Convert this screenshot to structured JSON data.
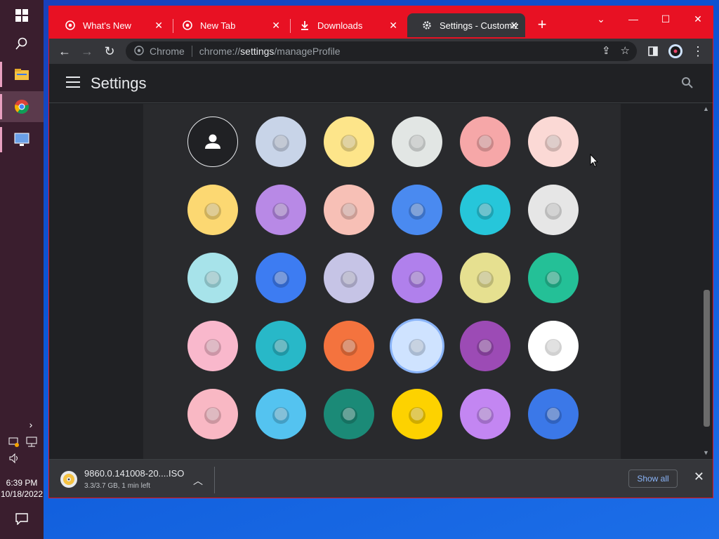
{
  "taskbar": {
    "start_icon": "windows-start-icon",
    "search_icon": "search-icon",
    "apps": [
      {
        "name": "file-explorer-icon"
      },
      {
        "name": "chrome-icon"
      },
      {
        "name": "remote-desktop-icon"
      }
    ],
    "time": "6:39 PM",
    "date": "10/18/2022"
  },
  "browser": {
    "tabs": [
      {
        "title": "What's New",
        "icon": "chrome-icon"
      },
      {
        "title": "New Tab",
        "icon": "chrome-icon"
      },
      {
        "title": "Downloads",
        "icon": "download-icon"
      },
      {
        "title": "Settings - Customiz",
        "icon": "gear-icon",
        "active": true
      }
    ],
    "omnibox": {
      "chip": "Chrome",
      "url_prefix": "chrome://",
      "url_host": "settings",
      "url_path": "/manageProfile"
    }
  },
  "settings": {
    "title": "Settings"
  },
  "avatars": [
    {
      "name": "avatar-default",
      "bg": "#202124",
      "ring": "#e8eaed"
    },
    {
      "name": "avatar-cat",
      "bg": "#c8d4e8"
    },
    {
      "name": "avatar-corgi",
      "bg": "#fde58a"
    },
    {
      "name": "avatar-dragon",
      "bg": "#e2e6e4"
    },
    {
      "name": "avatar-elephant",
      "bg": "#f6a7a8"
    },
    {
      "name": "avatar-fox",
      "bg": "#fbd9d5"
    },
    {
      "name": "avatar-monkey",
      "bg": "#fcd872"
    },
    {
      "name": "avatar-panda",
      "bg": "#b889e6"
    },
    {
      "name": "avatar-penguin",
      "bg": "#f7c0b6"
    },
    {
      "name": "avatar-butterfly",
      "bg": "#4a8af0"
    },
    {
      "name": "avatar-rabbit",
      "bg": "#26c6da"
    },
    {
      "name": "avatar-unicorn",
      "bg": "#e6e6e6"
    },
    {
      "name": "avatar-basketball",
      "bg": "#a7e3ea"
    },
    {
      "name": "avatar-bike",
      "bg": "#3d7cf2"
    },
    {
      "name": "avatar-bird",
      "bg": "#c6c4e6"
    },
    {
      "name": "avatar-cheese",
      "bg": "#b080ec"
    },
    {
      "name": "avatar-football",
      "bg": "#e6e090"
    },
    {
      "name": "avatar-ramen",
      "bg": "#24c097"
    },
    {
      "name": "avatar-sunglasses",
      "bg": "#f9b8cc"
    },
    {
      "name": "avatar-sushi",
      "bg": "#28b8c8"
    },
    {
      "name": "avatar-tamagotchi",
      "bg": "#f4733e"
    },
    {
      "name": "avatar-vinyl",
      "bg": "#cfe3ff",
      "selected": true
    },
    {
      "name": "avatar-avocado",
      "bg": "#9c4bb5"
    },
    {
      "name": "avatar-camera",
      "bg": "#ffffff"
    },
    {
      "name": "avatar-ice-cream",
      "bg": "#f9b8c4"
    },
    {
      "name": "avatar-glasses",
      "bg": "#54c3f0"
    },
    {
      "name": "avatar-watermelon",
      "bg": "#1b8a77"
    },
    {
      "name": "avatar-onigiri",
      "bg": "#fdd200"
    },
    {
      "name": "avatar-pizza",
      "bg": "#c386f2"
    },
    {
      "name": "avatar-sandwich",
      "bg": "#3b78e8"
    }
  ],
  "downloads": {
    "filename": "9860.0.141008-20....ISO",
    "status": "3.3/3.7 GB, 1 min left",
    "show_all": "Show all"
  },
  "colors": {
    "accent_red": "#e81123",
    "link_blue": "#8ab4f8",
    "dark_bg": "#202124",
    "card_bg": "#292a2d"
  }
}
